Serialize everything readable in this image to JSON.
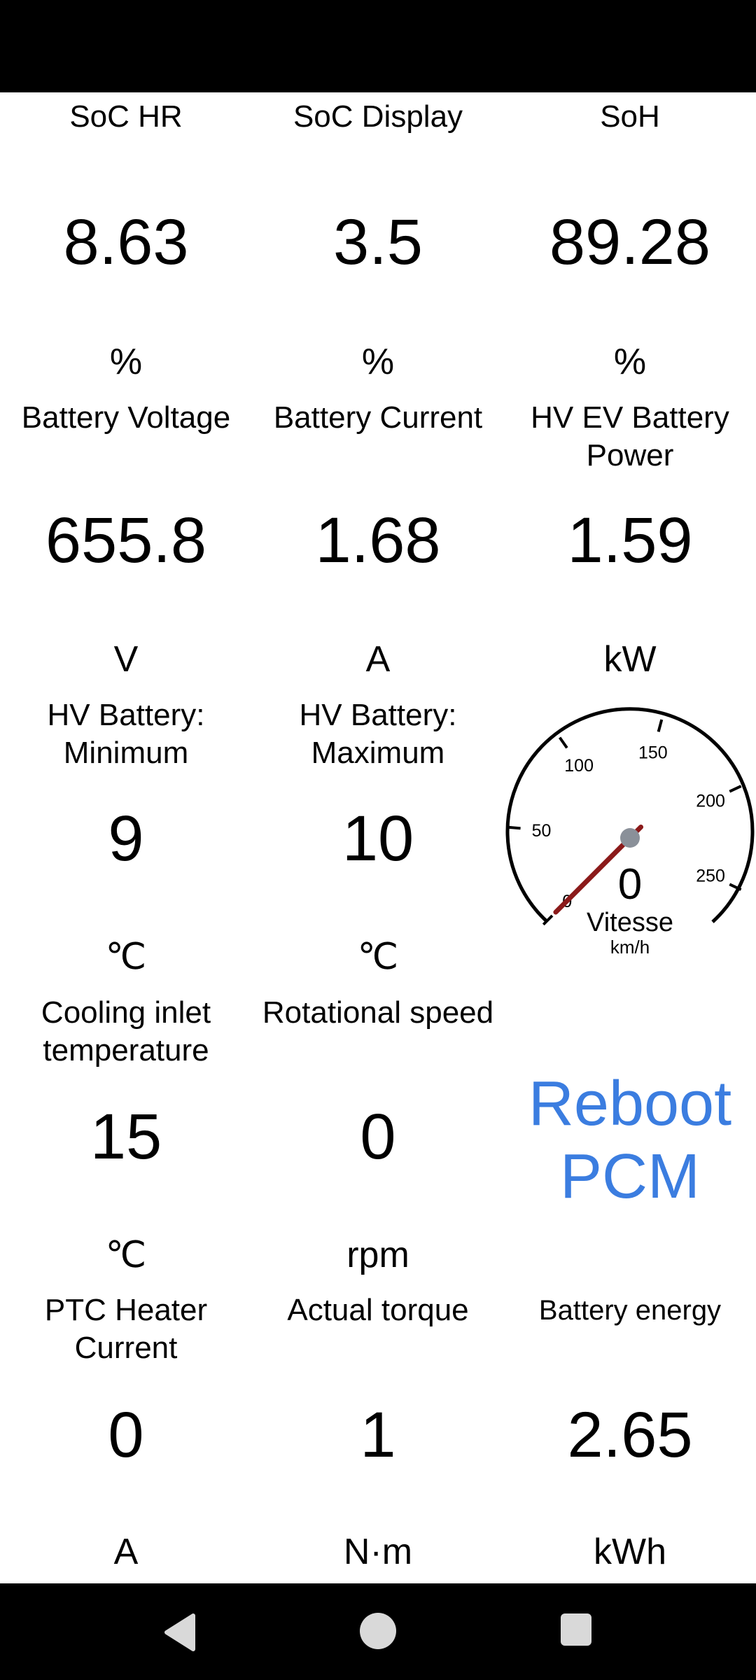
{
  "metrics": [
    {
      "label": "SoC HR",
      "value": "8.63",
      "unit": "%"
    },
    {
      "label": "SoC Display",
      "value": "3.5",
      "unit": "%"
    },
    {
      "label": "SoH",
      "value": "89.28",
      "unit": "%"
    },
    {
      "label": "Battery Voltage",
      "value": "655.8",
      "unit": "V"
    },
    {
      "label": "Battery Current",
      "value": "1.68",
      "unit": "A"
    },
    {
      "label_line1": "HV EV Battery",
      "label_line2": "Power",
      "value": "1.59",
      "unit": "kW"
    },
    {
      "label_line1": "HV Battery:",
      "label_line2": "Minimum",
      "value": "9",
      "unit": "℃"
    },
    {
      "label_line1": "HV Battery:",
      "label_line2": "Maximum",
      "value": "10",
      "unit": "℃"
    },
    {
      "label_line1": "Cooling inlet",
      "label_line2": "temperature",
      "value": "15",
      "unit": "℃"
    },
    {
      "label": "Rotational speed",
      "value": "0",
      "unit": "rpm"
    },
    {
      "label_line1": "PTC Heater",
      "label_line2": "Current",
      "value": "0",
      "unit": "A"
    },
    {
      "label": "Actual torque",
      "value": "1",
      "unit": "N·m"
    },
    {
      "label": "Battery energy",
      "value": "2.65",
      "unit": "kWh"
    }
  ],
  "gauge": {
    "title": "Vitesse",
    "unit": "km/h",
    "value": "0",
    "ticks": [
      "0",
      "50",
      "100",
      "150",
      "200",
      "250"
    ],
    "needle_color": "#8b1a1a",
    "hub_color": "#8a9099"
  },
  "reboot": {
    "line1": "Reboot",
    "line2": "PCM",
    "color": "#3b7de0"
  },
  "nav": {
    "back": "back-icon",
    "home": "home-icon",
    "recents": "recents-icon"
  }
}
